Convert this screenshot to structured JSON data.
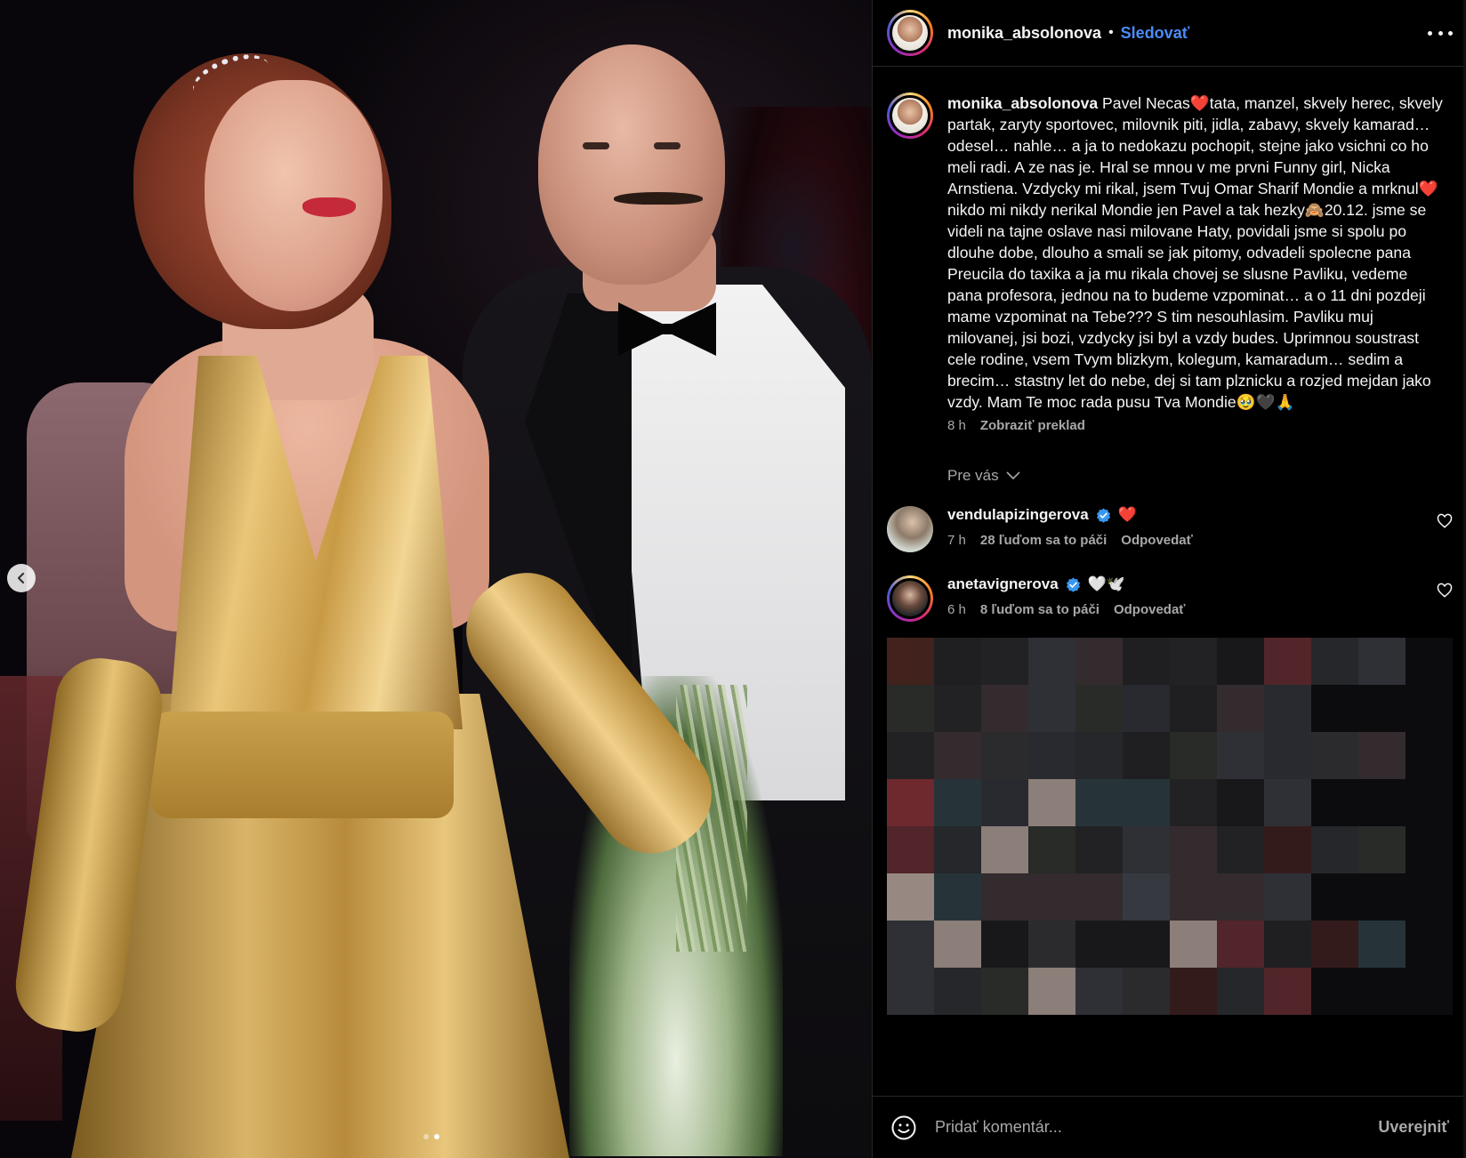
{
  "header": {
    "username": "monika_absolonova",
    "separator": "•",
    "follow_label": "Sledovať"
  },
  "caption": {
    "username": "monika_absolonova",
    "text": "Pavel Necas❤️tata, manzel, skvely herec, skvely partak, zaryty sportovec, milovnik piti, jidla, zabavy, skvely kamarad… odesel… nahle… a ja to nedokazu pochopit, stejne jako vsichni co ho meli radi. A ze nas je. Hral se mnou v me prvni Funny girl, Nicka Arnstiena. Vzdycky mi rikal, jsem Tvuj Omar Sharif Mondie a mrknul❤️nikdo mi nikdy nerikal Mondie jen Pavel a tak hezky🙈20.12. jsme se videli na tajne oslave nasi milovane Haty, povidali jsme si spolu po dlouhe dobe, dlouho a smali se jak pitomy, odvadeli spolecne pana Preucila do taxika a ja mu rikala chovej se slusne Pavliku, vedeme pana profesora, jednou na to budeme vzpominat… a o 11 dni pozdeji mame vzpominat na Tebe??? S tim nesouhlasim. Pavliku muj milovanej, jsi bozi, vzdycky jsi byl a vzdy budes. Uprimnou soustrast cele rodine, vsem Tvym blizkym, kolegum, kamaradum… sedim a brecim… stastny let do nebe, dej si tam plznicku a rozjed mejdan jako vzdy. Mam Te moc rada pusu Tva Mondie🥹🖤🙏",
    "time": "8 h",
    "translate_label": "Zobraziť preklad"
  },
  "for_you": {
    "label": "Pre vás"
  },
  "comments": [
    {
      "username": "vendulapizingerova",
      "text": "❤️",
      "time": "7 h",
      "likes": "28 ľuďom sa to páči",
      "reply_label": "Odpovedať"
    },
    {
      "username": "anetavignerova",
      "text": "🤍🕊️",
      "time": "6 h",
      "likes": "8 ľuďom sa to páči",
      "reply_label": "Odpovedať"
    }
  ],
  "footer": {
    "placeholder": "Pridať komentár...",
    "post_label": "Uverejniť"
  },
  "colors": {
    "accent": "#4a8cf7",
    "background": "#000000",
    "secondary_text": "#a8a8a8"
  },
  "carousel": {
    "current": 2,
    "total": 2
  }
}
